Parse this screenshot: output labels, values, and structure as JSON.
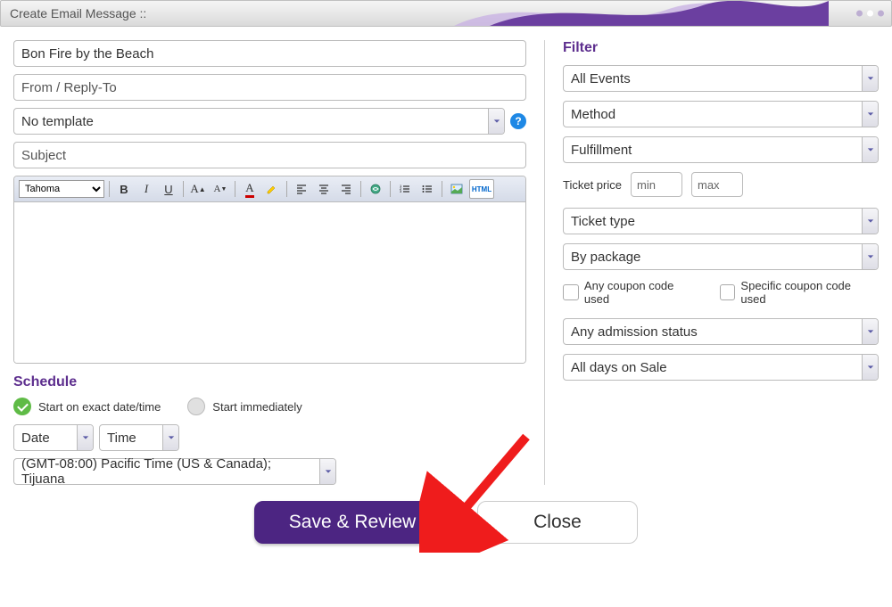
{
  "window": {
    "title": "Create Email Message ::"
  },
  "left": {
    "event_name": "Bon Fire by the Beach",
    "from_placeholder": "From / Reply-To",
    "template": "No template",
    "subject_placeholder": "Subject",
    "font": "Tahoma"
  },
  "schedule": {
    "title": "Schedule",
    "opt_exact": "Start on exact date/time",
    "opt_now": "Start immediately",
    "date_placeholder": "Date",
    "time_placeholder": "Time",
    "timezone": "(GMT-08:00) Pacific Time (US & Canada); Tijuana"
  },
  "filter": {
    "title": "Filter",
    "events": "All Events",
    "method": "Method",
    "fulfillment": "Fulfillment",
    "price_label": "Ticket price",
    "min_placeholder": "min",
    "max_placeholder": "max",
    "ticket_type": "Ticket type",
    "by_package": "By package",
    "coupon_any": "Any coupon code used",
    "coupon_specific": "Specific coupon code used",
    "admission": "Any admission status",
    "days": "All days on Sale"
  },
  "buttons": {
    "save": "Save & Review",
    "close": "Close"
  }
}
